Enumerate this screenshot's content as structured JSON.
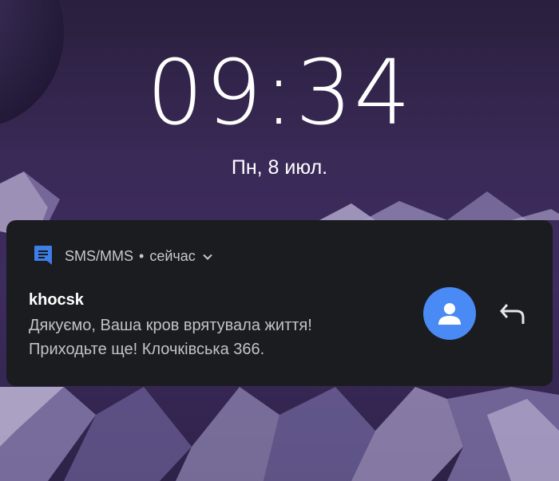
{
  "lockscreen": {
    "time": "09:34",
    "date": "Пн, 8 июл."
  },
  "notification": {
    "app_name": "SMS/MMS",
    "separator": "•",
    "timestamp": "сейчас",
    "sender": "khocsk",
    "message_line1": "Дякуємо, Ваша кров врятувала життя!",
    "message_line2": "Приходьте ще! Клочківська 366.",
    "app_icon": "message-icon",
    "avatar_icon": "person-icon",
    "reply_icon": "reply-icon",
    "expand_icon": "chevron-down-icon"
  },
  "colors": {
    "card_background": "#1b1c20",
    "avatar_background": "#4a8af4",
    "app_icon": "#3d7ee8"
  }
}
